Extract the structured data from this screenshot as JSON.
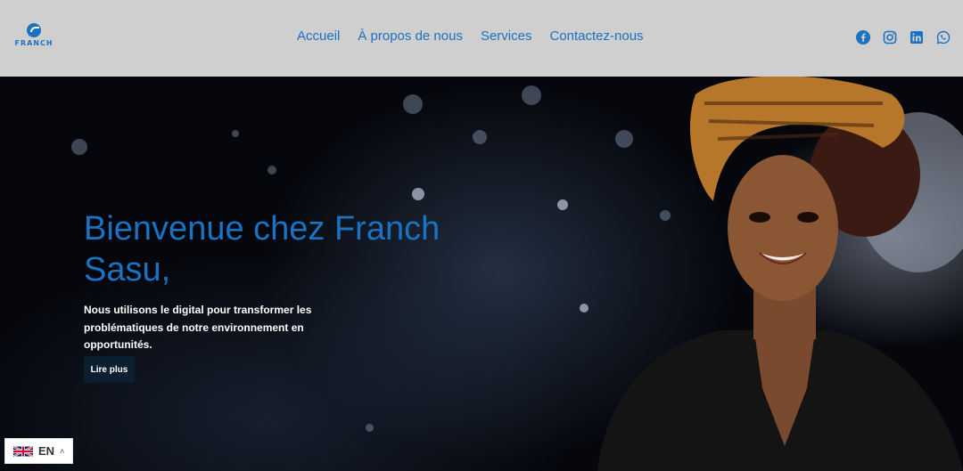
{
  "header": {
    "logo_text": "FRANCH",
    "nav": [
      {
        "label": "Accueil"
      },
      {
        "label": "À propos de nous"
      },
      {
        "label": "Services"
      },
      {
        "label": "Contactez-nous"
      }
    ],
    "social_icons": [
      "facebook-icon",
      "instagram-icon",
      "linkedin-icon",
      "whatsapp-icon"
    ]
  },
  "hero": {
    "title": "Bienvenue chez Franch Sasu,",
    "text": "Nous utilisons le digital pour transformer les problématiques de notre environnement en opportunités.",
    "button_label": "Lire plus"
  },
  "language": {
    "code": "EN",
    "flag_icon": "uk-flag-icon",
    "caret_icon": "chevron-up-icon"
  },
  "colors": {
    "accent": "#1a72c2",
    "header_bg": "#cfcfcf",
    "button_bg": "#0c1f2e"
  }
}
